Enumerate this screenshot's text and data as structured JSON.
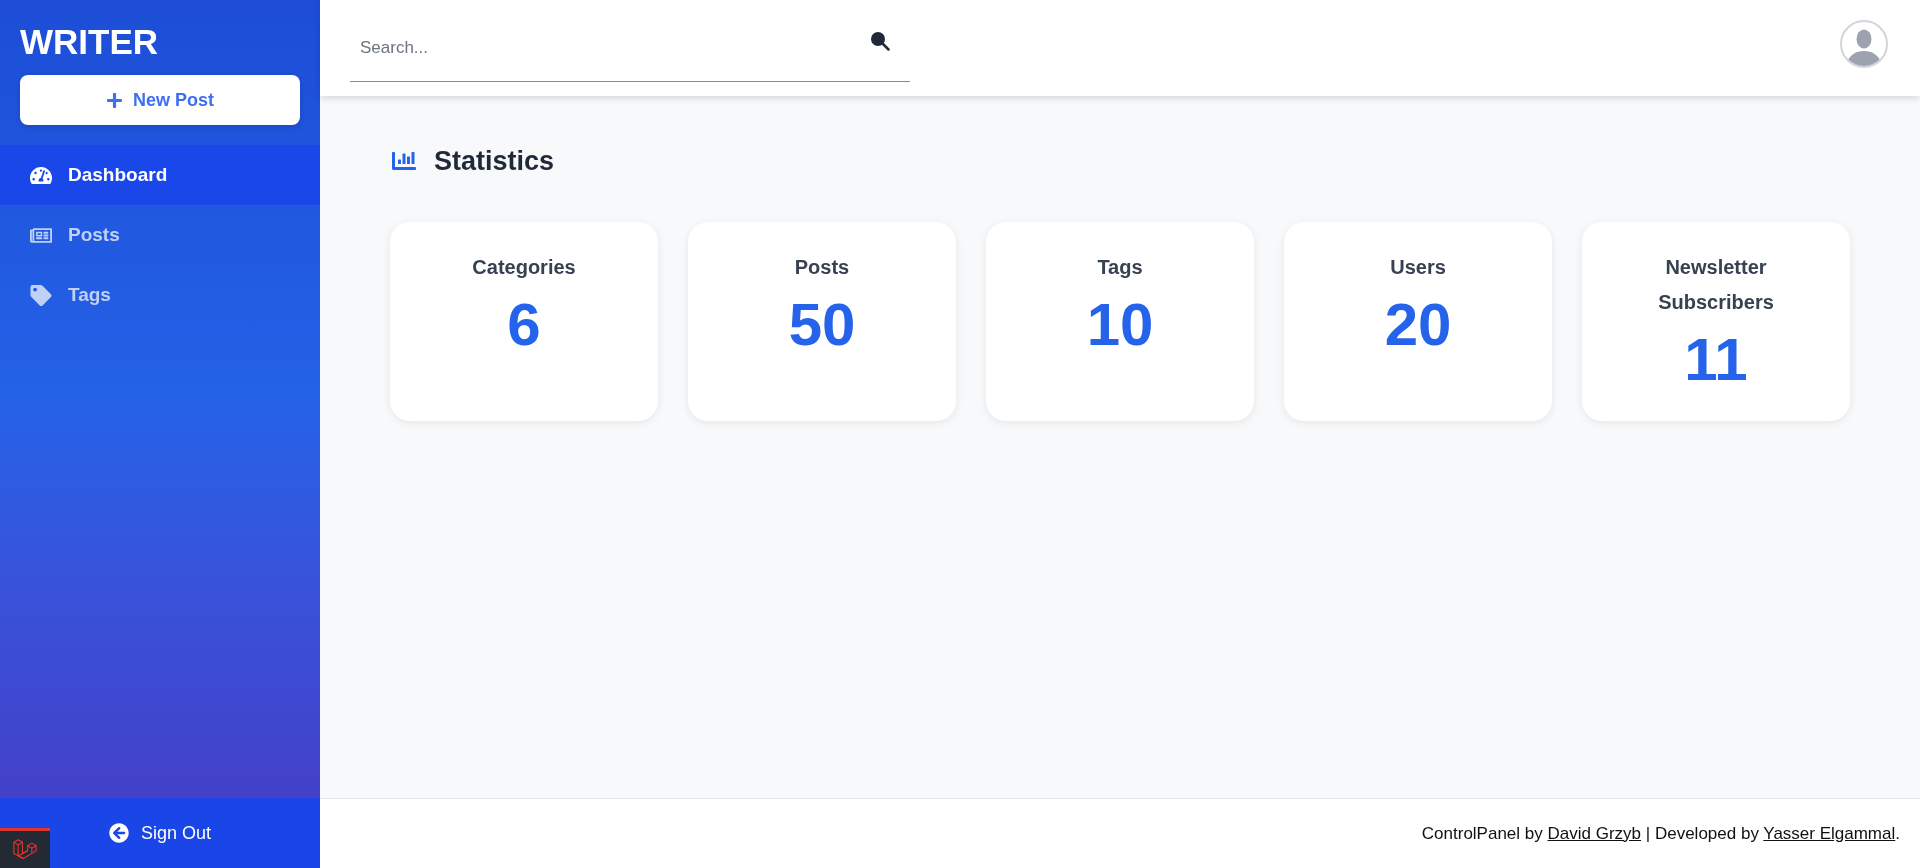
{
  "sidebar": {
    "brand": "WRITER",
    "new_post_button": "New Post",
    "items": [
      {
        "label": "Dashboard",
        "selected": true
      },
      {
        "label": "Posts",
        "selected": false
      },
      {
        "label": "Tags",
        "selected": false
      }
    ],
    "sign_out": "Sign Out"
  },
  "header": {
    "search": {
      "placeholder": "Search..."
    }
  },
  "main": {
    "title": "Statistics",
    "stats": [
      {
        "label": "Categories",
        "value": "6"
      },
      {
        "label": "Posts",
        "value": "50"
      },
      {
        "label": "Tags",
        "value": "10"
      },
      {
        "label": "Users",
        "value": "20"
      },
      {
        "label": "Newsletter Subscribers",
        "value": "11"
      }
    ]
  },
  "footer": {
    "credits": [
      {
        "text": "ControlPanel by",
        "link": "David Grzyb"
      },
      {
        "text": "| Developed by",
        "link": "Yasser Elgammal"
      }
    ],
    "end": "."
  }
}
